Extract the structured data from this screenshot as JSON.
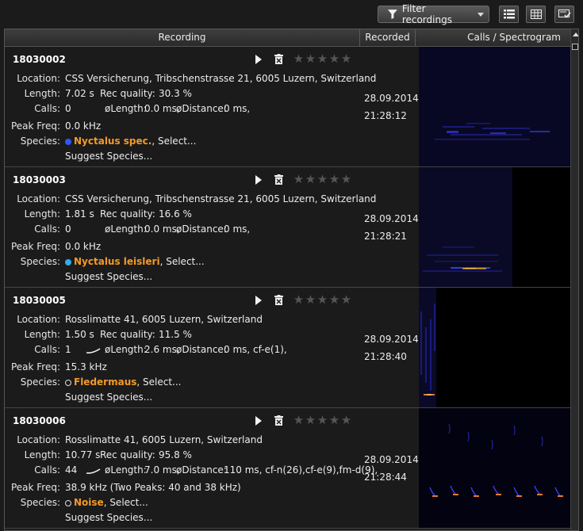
{
  "toolbar": {
    "filter_label": "Filter recordings",
    "icons": [
      "funnel-icon",
      "list-view-icon",
      "grid-view-icon",
      "select-all-icon"
    ]
  },
  "columns": {
    "recording": "Recording",
    "recorded": "Recorded",
    "calls": "Calls / Spectrogram"
  },
  "labels": {
    "location": "Location:",
    "length": "Length:",
    "calls": "Calls:",
    "peak_freq": "Peak Freq:",
    "species": "Species:",
    "rec_quality": "Rec quality:",
    "avg_length": "øLength:",
    "avg_distance": "øDistance:",
    "select": ", Select...",
    "suggest": "Suggest Species..."
  },
  "colors": {
    "accent_species": "#f29a28",
    "dot_blue": "#3355ff",
    "dot_light_blue": "#39a9e8"
  },
  "recordings": [
    {
      "id": "18030002",
      "location": "CSS Versicherung, Tribschenstrasse 21, 6005 Luzern, Switzerland",
      "length": "7.02 s",
      "rec_quality": "30.3 %",
      "calls": "0",
      "avg_length": "0.0 ms,",
      "avg_distance": "0 ms,",
      "peak_freq": "0.0 kHz",
      "species": "Nyctalus spec.",
      "date": "28.09.2014",
      "time": "21:28:12",
      "rating": 0
    },
    {
      "id": "18030003",
      "location": "CSS Versicherung, Tribschenstrasse 21, 6005 Luzern, Switzerland",
      "length": "1.81 s",
      "rec_quality": "16.6 %",
      "calls": "0",
      "avg_length": "0.0 ms,",
      "avg_distance": "0 ms,",
      "peak_freq": "0.0 kHz",
      "species": "Nyctalus leisleri",
      "date": "28.09.2014",
      "time": "21:28:21",
      "rating": 0
    },
    {
      "id": "18030005",
      "location": "Rosslimatte 41, 6005 Luzern, Switzerland",
      "length": "1.50 s",
      "rec_quality": "11.5 %",
      "calls": "1",
      "avg_length": "2.6 ms,",
      "avg_distance": "0 ms, cf-e(1),",
      "peak_freq": "15.3 kHz",
      "species": "Fledermaus",
      "date": "28.09.2014",
      "time": "21:28:40",
      "rating": 0
    },
    {
      "id": "18030006",
      "location": "Rosslimatte 41, 6005 Luzern, Switzerland",
      "length": "10.77 s",
      "rec_quality": "95.8 %",
      "calls": "44",
      "avg_length": "7.0 ms,",
      "avg_distance": "110 ms, cf-n(26),cf-e(9),fm-d(9),",
      "peak_freq": "38.9 kHz (Two Peaks: 40 and 38 kHz)",
      "species": "Noise",
      "date": "28.09.2014",
      "time": "21:28:44",
      "rating": 0
    }
  ]
}
